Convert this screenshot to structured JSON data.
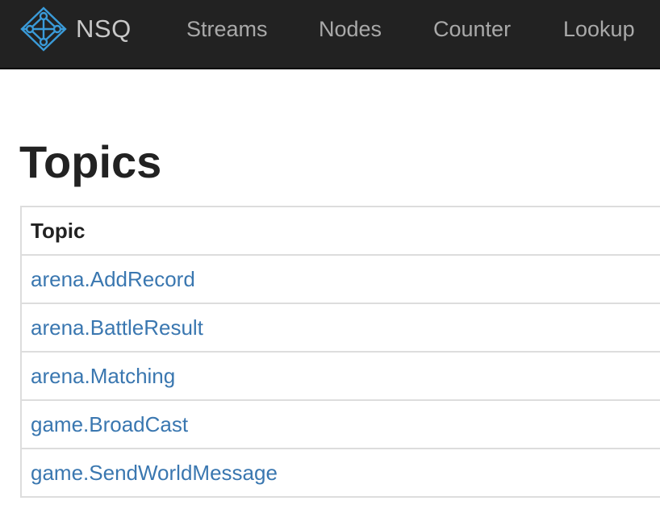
{
  "navbar": {
    "brand": "NSQ",
    "items": [
      {
        "label": "Streams"
      },
      {
        "label": "Nodes"
      },
      {
        "label": "Counter"
      },
      {
        "label": "Lookup"
      }
    ],
    "background_color": "#222222",
    "logo_color": "#3a9bd9"
  },
  "page": {
    "title": "Topics"
  },
  "table": {
    "header": "Topic",
    "rows": [
      {
        "topic": "arena.AddRecord"
      },
      {
        "topic": "arena.BattleResult"
      },
      {
        "topic": "arena.Matching"
      },
      {
        "topic": "game.BroadCast"
      },
      {
        "topic": "game.SendWorldMessage"
      }
    ],
    "link_color": "#3a77b0"
  }
}
